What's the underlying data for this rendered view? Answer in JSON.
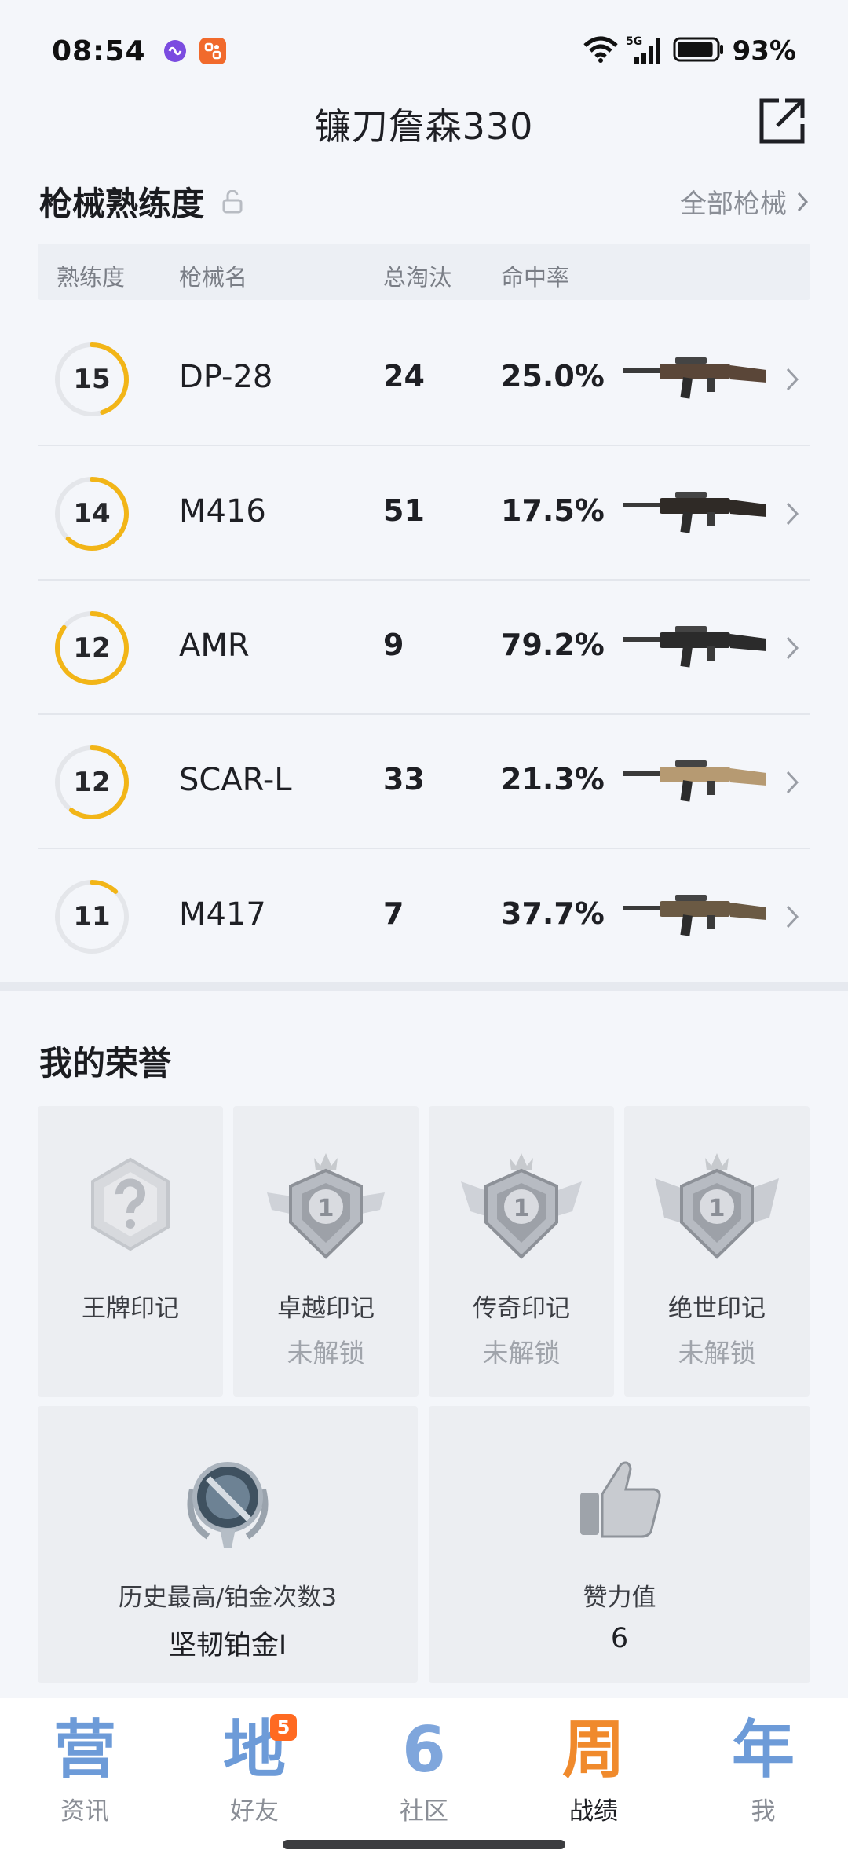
{
  "status_bar": {
    "time": "08:54",
    "network": "5G",
    "battery_percent": "93%",
    "battery_level": 0.93
  },
  "header": {
    "title": "镰刀詹森330",
    "share_icon": "share-icon"
  },
  "weapons": {
    "title": "枪械熟练度",
    "all_link": "全部枪械",
    "columns": [
      "熟练度",
      "枪械名",
      "总淘汰",
      "命中率"
    ],
    "rows": [
      {
        "level": "15",
        "name": "DP-28",
        "kills": "24",
        "rate": "25.0%",
        "progress": 0.45
      },
      {
        "level": "14",
        "name": "M416",
        "kills": "51",
        "rate": "17.5%",
        "progress": 0.62
      },
      {
        "level": "12",
        "name": "AMR",
        "kills": "9",
        "rate": "79.2%",
        "progress": 0.85
      },
      {
        "level": "12",
        "name": "SCAR-L",
        "kills": "33",
        "rate": "21.3%",
        "progress": 0.6
      },
      {
        "level": "11",
        "name": "M417",
        "kills": "7",
        "rate": "37.7%",
        "progress": 0.12
      }
    ],
    "ring_color": "#f2b517"
  },
  "honors": {
    "title": "我的荣誉",
    "marks": [
      {
        "label": "王牌印记",
        "status": ""
      },
      {
        "label": "卓越印记",
        "status": "未解锁"
      },
      {
        "label": "传奇印记",
        "status": "未解锁"
      },
      {
        "label": "绝世印记",
        "status": "未解锁"
      }
    ],
    "rank": {
      "caption": "历史最高/铂金次数3",
      "value": "坚韧铂金I"
    },
    "likes": {
      "caption": "赞力值",
      "value": "6"
    }
  },
  "bottom_nav": {
    "items": [
      {
        "glyph": "营",
        "label": "资讯",
        "active": false
      },
      {
        "glyph": "地",
        "label": "好友",
        "active": false,
        "badge": "5"
      },
      {
        "glyph": "6",
        "label": "社区",
        "active": false
      },
      {
        "glyph": "周",
        "label": "战绩",
        "active": true
      },
      {
        "glyph": "年",
        "label": "我",
        "active": false
      }
    ]
  }
}
